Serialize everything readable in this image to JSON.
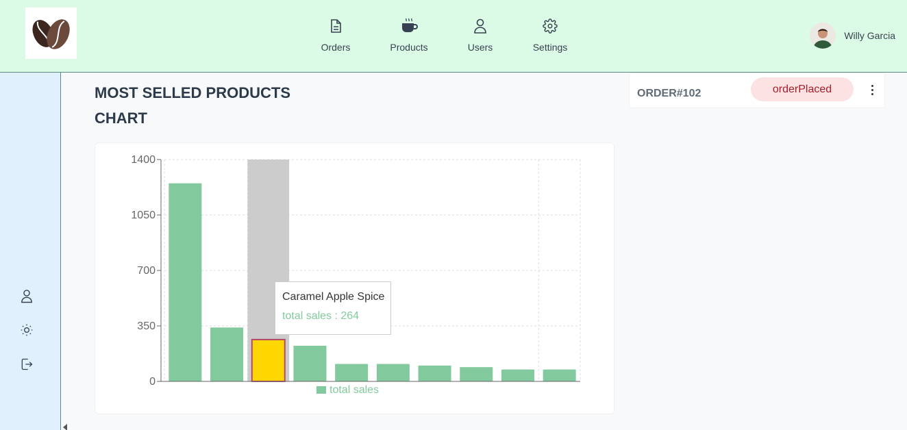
{
  "nav": {
    "items": [
      {
        "label": "Orders",
        "icon": "document-icon"
      },
      {
        "label": "Products",
        "icon": "coffee-cup-icon"
      },
      {
        "label": "Users",
        "icon": "user-icon"
      },
      {
        "label": "Settings",
        "icon": "gear-icon"
      }
    ]
  },
  "user": {
    "name": "Willy Garcia"
  },
  "sidebar": {
    "icons": [
      "user-icon",
      "sun-icon",
      "logout-icon"
    ]
  },
  "main": {
    "title": "MOST SELLED PRODUCTS CHART"
  },
  "order": {
    "id": "ORDER#102",
    "status": "orderPlaced"
  },
  "tooltip": {
    "title": "Caramel Apple Spice",
    "value_label": "total sales : 264"
  },
  "colors": {
    "bar": "#82ca9d",
    "highlight_bar": "#ffd700",
    "cursor": "#cccccc",
    "topbar": "#dcfbe6",
    "sidebar": "#e0f0fc",
    "status_bg": "#fde2e4",
    "status_text": "#a61e26"
  },
  "chart_data": {
    "type": "bar",
    "categories": [
      "",
      "",
      "Caramel Apple Spice",
      "",
      "",
      "",
      "",
      "",
      "",
      ""
    ],
    "series": [
      {
        "name": "total sales",
        "values": [
          1250,
          340,
          264,
          225,
          110,
          110,
          100,
          90,
          75,
          75
        ]
      }
    ],
    "ylim": [
      0,
      1400
    ],
    "yticks": [
      0,
      350,
      700,
      1050,
      1400
    ],
    "grid": true,
    "legend_position": "bottom",
    "highlighted_category_index": 2
  }
}
